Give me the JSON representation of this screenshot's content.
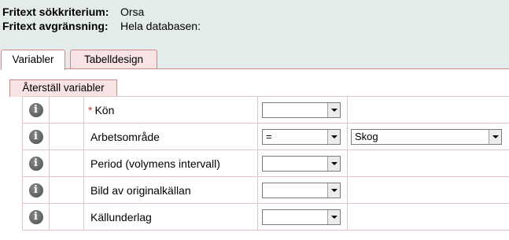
{
  "header": {
    "search_criteria_label": "Fritext sökkriterium:",
    "search_criteria_value": "Orsa",
    "restriction_label": "Fritext avgränsning:",
    "restriction_value": "Hela databasen:"
  },
  "tabs": [
    {
      "label": "Variabler",
      "active": true
    },
    {
      "label": "Tabelldesign",
      "active": false
    }
  ],
  "reset_button": "Återställ variabler",
  "variables": [
    {
      "label": "Kön",
      "required": "*",
      "operator": "",
      "value": null
    },
    {
      "label": "Arbetsområde",
      "required": "",
      "operator": "=",
      "value": "Skog"
    },
    {
      "label": "Period (volymens intervall)",
      "required": "",
      "operator": "",
      "value": null
    },
    {
      "label": "Bild av originalkällan",
      "required": "",
      "operator": "",
      "value": null
    },
    {
      "label": "Källunderlag",
      "required": "",
      "operator": "",
      "value": null
    }
  ],
  "icons": {
    "info": "info-icon",
    "dropdown": "chevron-down-icon"
  },
  "colors": {
    "header_bg": "#e3eceb",
    "tab_border": "#c48a8a",
    "tab_inactive_bg": "#f7e3e3",
    "required": "#dd3333"
  }
}
